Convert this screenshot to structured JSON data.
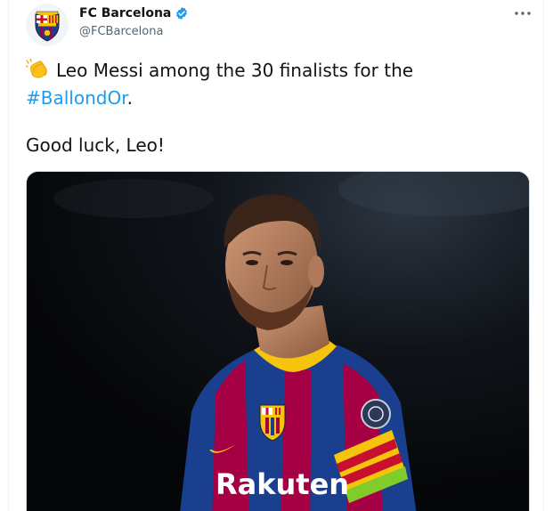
{
  "tweet": {
    "author_name": "FC Barcelona",
    "author_handle": "@FCBarcelona",
    "text_line1": "Leo Messi among the 30 finalists for the",
    "hashtag": "#BallondOr",
    "hashtag_suffix": ".",
    "text_line3": "Good luck, Leo!"
  },
  "photo": {
    "shirt_sponsor": "Rakuten"
  },
  "colors": {
    "hashtag_blue": "#1d9bf0",
    "verified_blue": "#1d9bf0",
    "barca_blue": "#1a3f8f",
    "barca_garnet": "#a50044",
    "captain_yellow": "#f6c40c"
  },
  "icons": {
    "verified": "verified-badge-icon",
    "more": "more-options-icon",
    "emoji": "clapping-hands-emoji"
  }
}
